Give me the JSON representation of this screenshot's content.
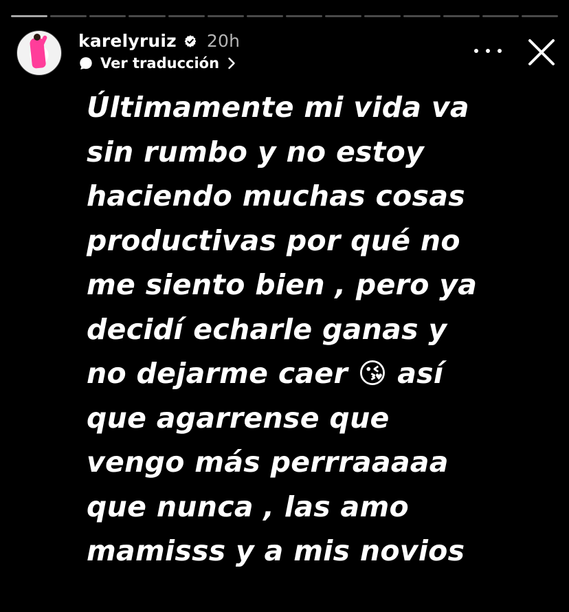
{
  "progress": {
    "segments": 14,
    "active_index": 0
  },
  "header": {
    "username": "karelyruiz",
    "time": "20h",
    "translate_label": "Ver traducción"
  },
  "story": {
    "lines": [
      "Últimamente mi vida va",
      "sin rumbo y no estoy",
      "haciendo muchas cosas",
      "productivas por qué no",
      "me siento bien , pero ya",
      "decidí echarle ganas y",
      "no dejarme caer 😘 así",
      "que agarrense que",
      "vengo más perrraaaaa",
      "que nunca , las amo",
      "mamisss y a mis novios"
    ]
  },
  "icons": {
    "verified": "verified-badge-icon",
    "translate": "speech-bubble-icon",
    "more": "more-options-icon",
    "close": "close-icon"
  },
  "colors": {
    "background": "#000000",
    "text": "#ffffff",
    "progress_active": "#a8a8a8",
    "progress_inactive": "#4a4a4a"
  }
}
